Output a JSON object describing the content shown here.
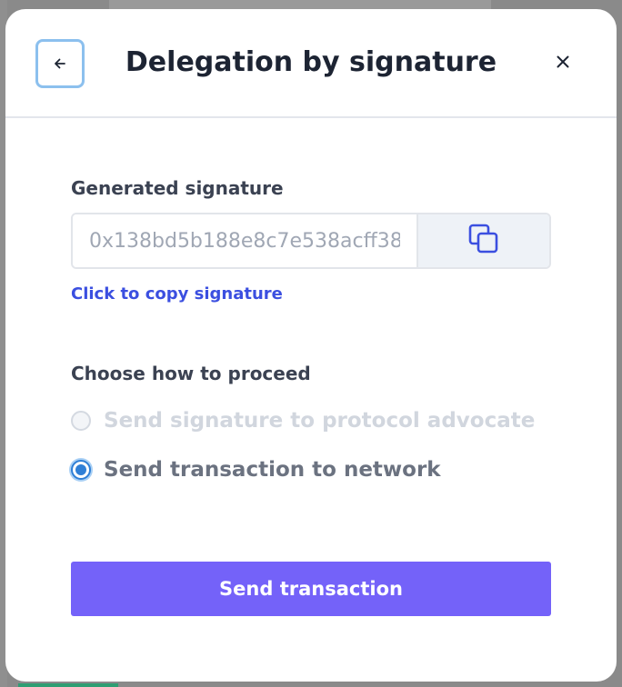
{
  "modal": {
    "title": "Delegation by signature"
  },
  "signature": {
    "label": "Generated signature",
    "value": "0x138bd5b188e8c7e538acff38",
    "copy_link": "Click to copy signature"
  },
  "proceed": {
    "label": "Choose how to proceed",
    "options": [
      {
        "label": "Send signature to protocol advocate",
        "state": "disabled"
      },
      {
        "label": "Send transaction to network",
        "state": "checked"
      }
    ]
  },
  "actions": {
    "send_label": "Send transaction"
  },
  "colors": {
    "accent": "#7462f9",
    "link": "#3b4fe0",
    "radio_checked": "#2f7fd6",
    "back_border": "#8cc0ee"
  }
}
